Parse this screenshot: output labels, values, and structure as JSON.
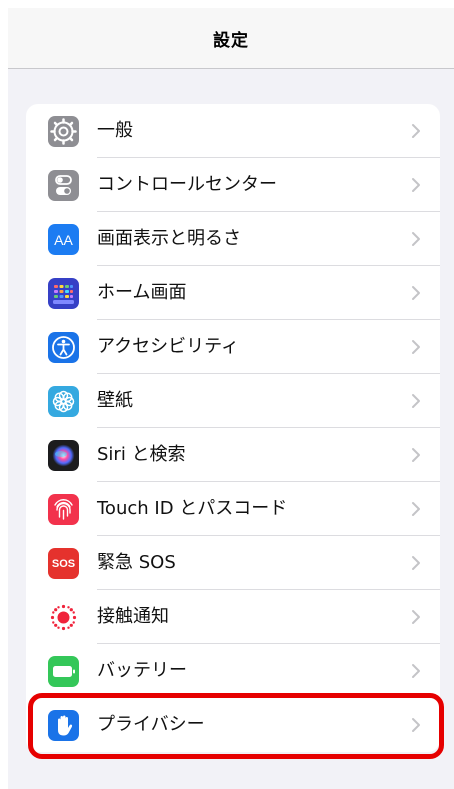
{
  "navbar": {
    "title": "設定"
  },
  "items": [
    {
      "label": "一般",
      "icon": "gear-icon",
      "color": "#8e8e93"
    },
    {
      "label": "コントロールセンター",
      "icon": "toggles-icon",
      "color": "#8e8e93"
    },
    {
      "label": "画面表示と明るさ",
      "icon": "text-size-icon",
      "color": "#1c7cf2",
      "glyph": "AA"
    },
    {
      "label": "ホーム画面",
      "icon": "app-grid-icon",
      "color": "#3640c6"
    },
    {
      "label": "アクセシビリティ",
      "icon": "accessibility-icon",
      "color": "#1a73e8"
    },
    {
      "label": "壁紙",
      "icon": "flower-icon",
      "color": "#35a9e0"
    },
    {
      "label": "Siri と検索",
      "icon": "siri-icon",
      "color": "#1c1c1e"
    },
    {
      "label": "Touch ID とパスコード",
      "icon": "fingerprint-icon",
      "color": "#f2324c"
    },
    {
      "label": "緊急 SOS",
      "icon": "sos-icon",
      "color": "#e5322d",
      "glyph": "SOS"
    },
    {
      "label": "接触通知",
      "icon": "exposure-icon",
      "color": "#ffffff"
    },
    {
      "label": "バッテリー",
      "icon": "battery-icon",
      "color": "#34c759"
    },
    {
      "label": "プライバシー",
      "icon": "hand-icon",
      "color": "#1a73e8"
    }
  ],
  "highlight_color": "#e60000"
}
